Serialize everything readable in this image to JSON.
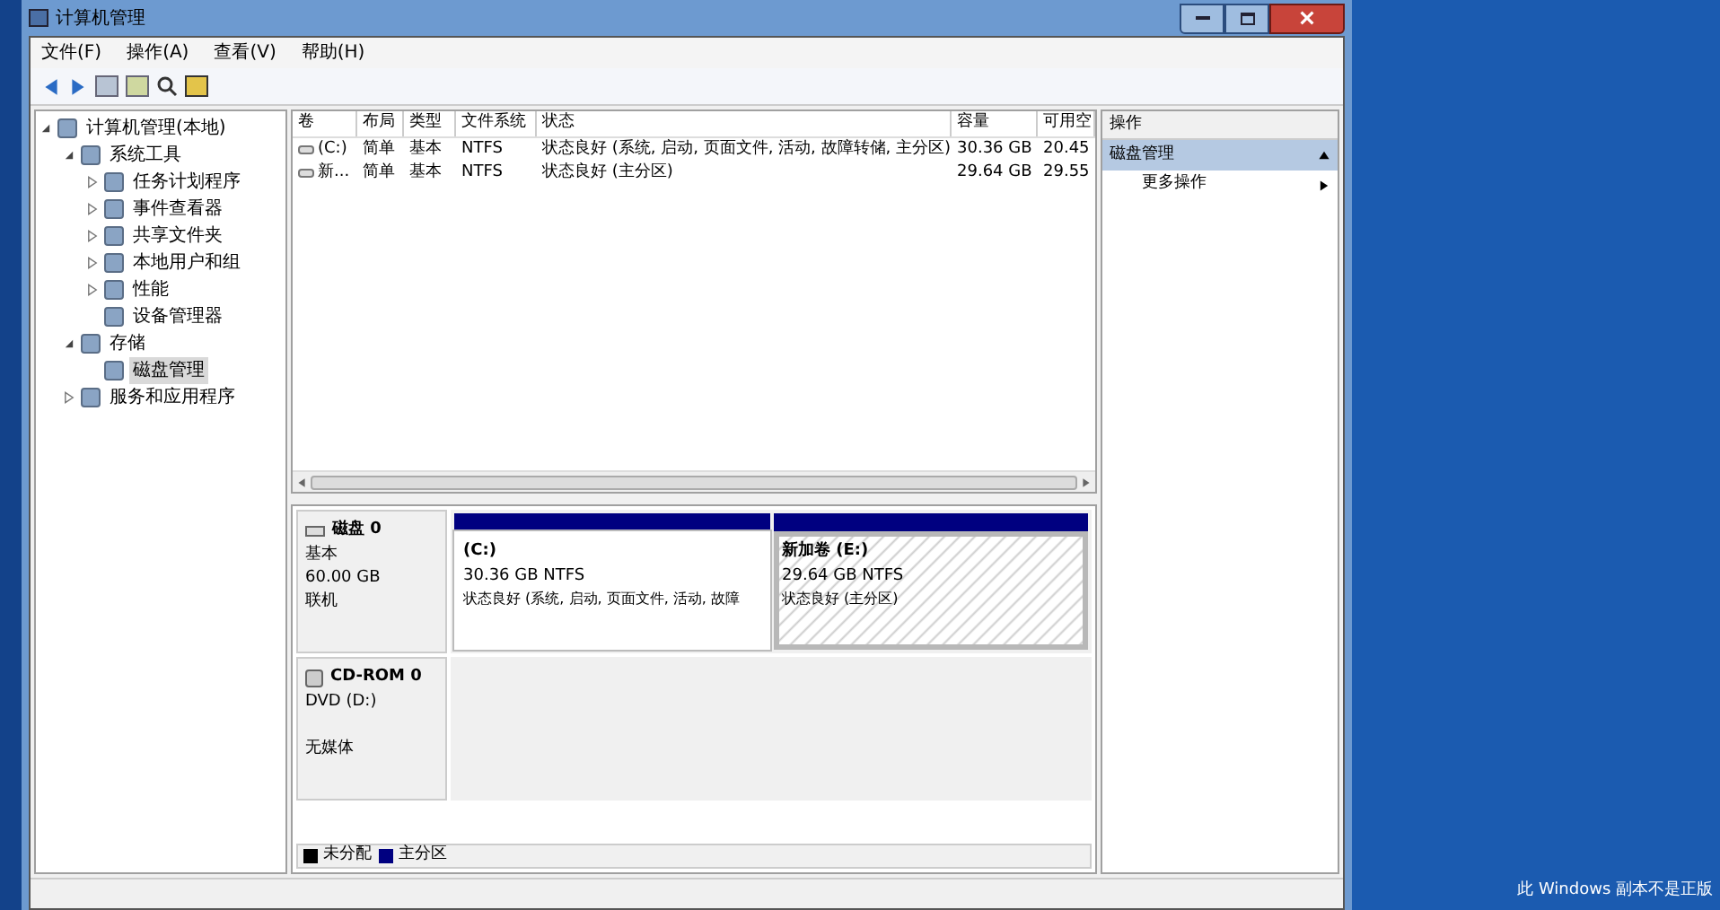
{
  "window": {
    "title": "计算机管理"
  },
  "menu": [
    "文件(F)",
    "操作(A)",
    "查看(V)",
    "帮助(H)"
  ],
  "tree": [
    {
      "label": "计算机管理(本地)",
      "expanded": true,
      "selected": false,
      "children": [
        {
          "label": "系统工具",
          "expanded": true,
          "selected": false,
          "children": [
            {
              "label": "任务计划程序",
              "expanded": false,
              "selected": false
            },
            {
              "label": "事件查看器",
              "expanded": false,
              "selected": false
            },
            {
              "label": "共享文件夹",
              "expanded": false,
              "selected": false
            },
            {
              "label": "本地用户和组",
              "expanded": false,
              "selected": false
            },
            {
              "label": "性能",
              "expanded": false,
              "selected": false
            },
            {
              "label": "设备管理器",
              "selected": false
            }
          ]
        },
        {
          "label": "存储",
          "expanded": true,
          "selected": false,
          "children": [
            {
              "label": "磁盘管理",
              "selected": true
            }
          ]
        },
        {
          "label": "服务和应用程序",
          "expanded": false,
          "selected": false
        }
      ]
    }
  ],
  "table": {
    "columns": [
      "卷",
      "布局",
      "类型",
      "文件系统",
      "状态",
      "容量",
      "可用空"
    ],
    "rows": [
      [
        "(C:)",
        "简单",
        "基本",
        "NTFS",
        "状态良好 (系统, 启动, 页面文件, 活动, 故障转储, 主分区)",
        "30.36 GB",
        "20.45"
      ],
      [
        "新...",
        "简单",
        "基本",
        "NTFS",
        "状态良好 (主分区)",
        "29.64 GB",
        "29.55"
      ]
    ]
  },
  "disks": [
    {
      "name": "磁盘 0",
      "kind": "disk",
      "lines": [
        "基本",
        "60.00 GB",
        "联机"
      ],
      "partitions": [
        {
          "title": "(C:)",
          "size": "30.36 GB NTFS",
          "status": "状态良好 (系统, 启动, 页面文件, 活动, 故障",
          "selected": false
        },
        {
          "title": "新加卷  (E:)",
          "size": "29.64 GB NTFS",
          "status": "状态良好 (主分区)",
          "selected": true
        }
      ]
    },
    {
      "name": "CD-ROM 0",
      "kind": "cdrom",
      "lines": [
        "DVD (D:)"
      ],
      "media": "无媒体"
    }
  ],
  "legend": [
    {
      "label": "未分配",
      "color": "#000000"
    },
    {
      "label": "主分区",
      "color": "#000080"
    }
  ],
  "actions": {
    "title": "操作",
    "section": "磁盘管理",
    "items": [
      "更多操作"
    ]
  },
  "desktop_text": "此 Windows 副本不是正版"
}
